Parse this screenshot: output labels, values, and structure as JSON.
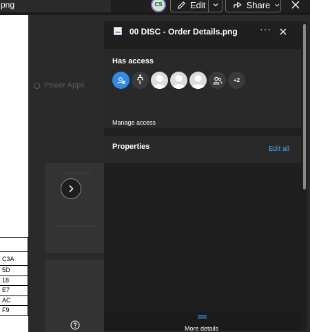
{
  "topbar": {
    "file_name_fragment": "png",
    "avatar_initials": "CS",
    "edit_label": "Edit",
    "share_label": "Share"
  },
  "background": {
    "power_apps_label": "Power Apps",
    "doc_cells": [
      "C3A",
      "5D",
      "18",
      "E7",
      "AC",
      "F9"
    ]
  },
  "details_pane": {
    "file_name": "00 DISC - Order Details.png",
    "more_glyph": "···",
    "has_access": {
      "title": "Has access",
      "group_count": "5",
      "more_count": "+2",
      "manage_label": "Manage access"
    },
    "properties": {
      "title": "Properties",
      "edit_all_label": "Edit all"
    },
    "footer": {
      "more_details_label": "More details"
    }
  },
  "colors": {
    "accent_link": "#4aa3ff",
    "access_link_icon_bg": "#2f8be8",
    "avatar_ring": "#8a63d2"
  }
}
